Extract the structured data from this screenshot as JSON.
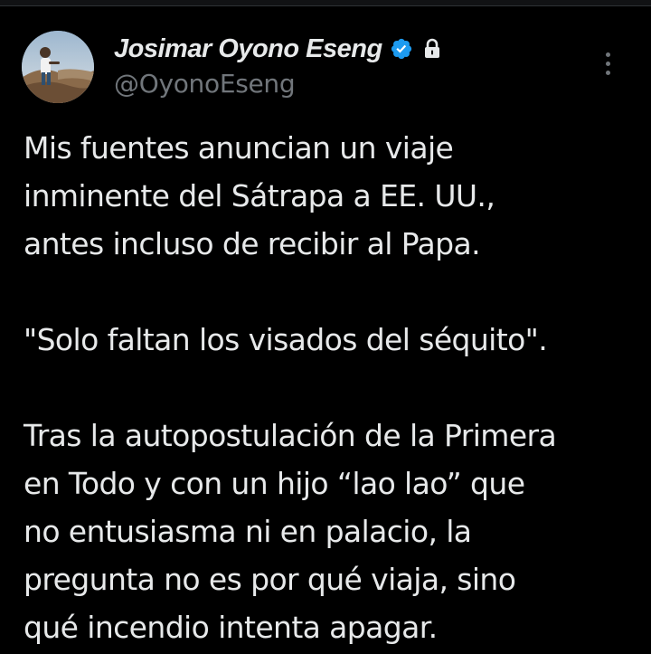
{
  "author": {
    "display_name": "Josimar Oyono Eseng",
    "handle": "@OyonoEseng",
    "verified": true,
    "protected": true
  },
  "icons": {
    "avatar": "profile-photo",
    "verified": "verified-badge-icon",
    "lock": "lock-icon",
    "more": "more-options-icon"
  },
  "colors": {
    "background": "#000000",
    "text": "#e7e9ea",
    "secondary_text": "#71767b",
    "verified_blue": "#1d9bf0"
  },
  "tweet": {
    "paragraphs": [
      {
        "lines": [
          "Mis fuentes anuncian un viaje",
          "inminente del Sátrapa a EE. UU.,",
          "antes incluso de recibir al Papa."
        ]
      },
      {
        "lines": [
          "\"Solo faltan los visados del séquito\"."
        ]
      },
      {
        "lines": [
          "Tras la autopostulación de la Primera",
          "en Todo y con un hijo “lao lao” que",
          "no entusiasma ni en palacio, la",
          "pregunta no es por qué viaja, sino",
          "qué incendio intenta apagar."
        ]
      }
    ]
  }
}
